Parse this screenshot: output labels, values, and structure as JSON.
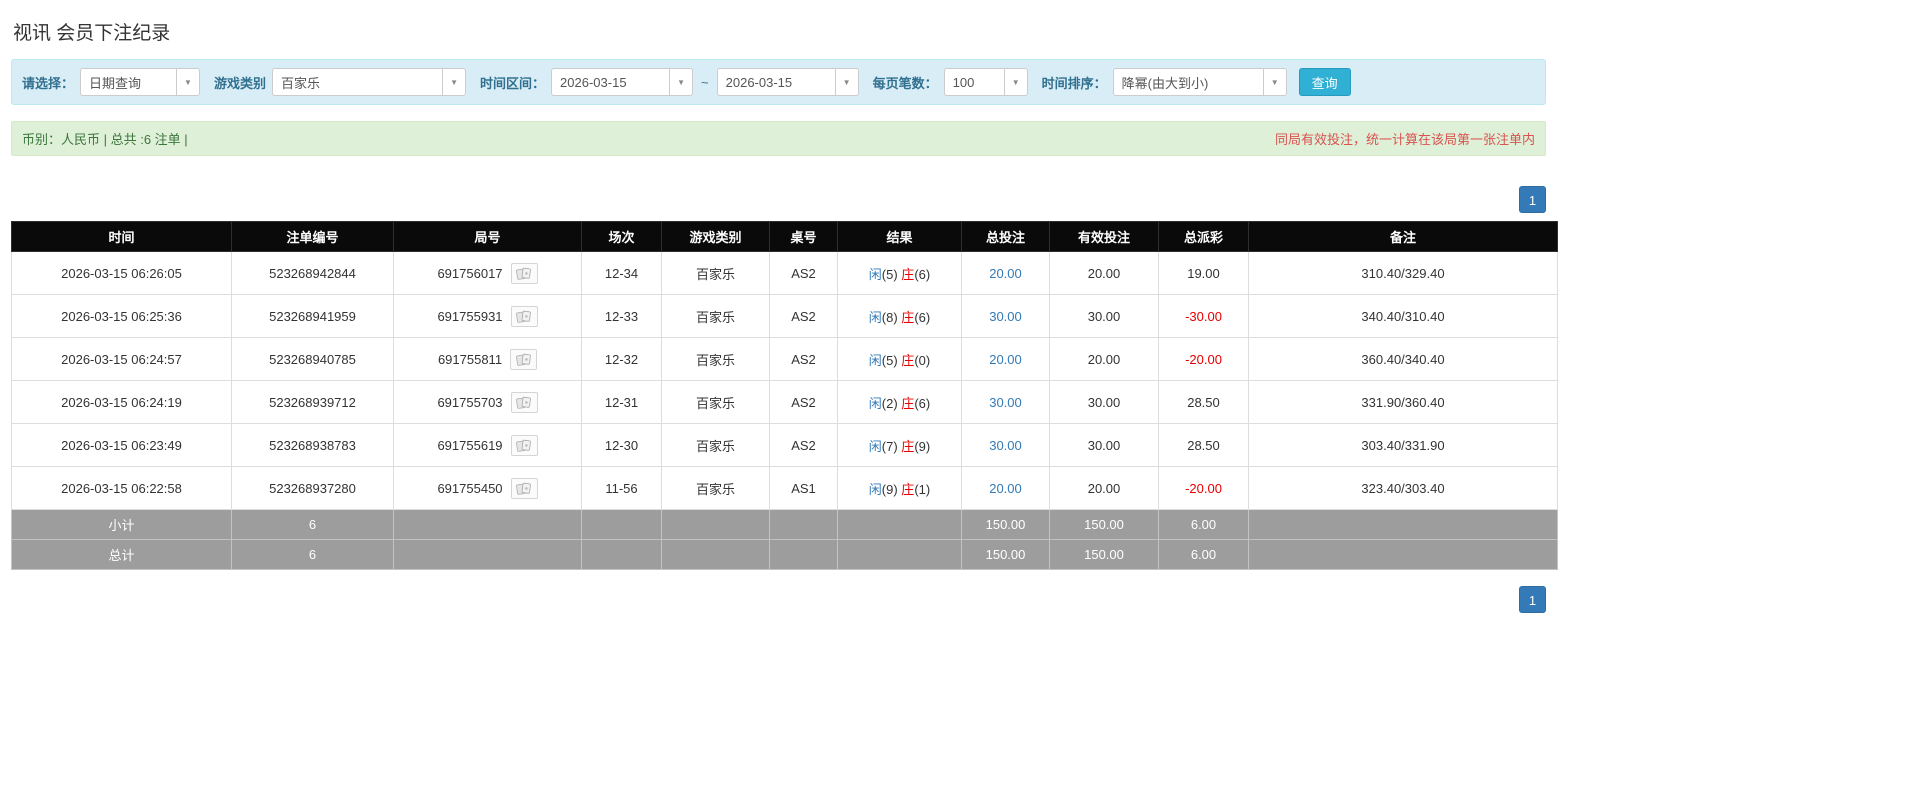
{
  "page": {
    "title": "视讯 会员下注纪录"
  },
  "icons": {
    "caret_down": "▼"
  },
  "colors": {
    "accent_blue": "#337ab7",
    "button_blue": "#31b0d5",
    "filter_bar_bg": "#d9edf7",
    "info_bar_bg": "#dff0d8",
    "info_text_green": "#3c763d",
    "warning_red": "#d9534f",
    "negative_red": "#e60000",
    "header_black": "#0a0a0a",
    "footer_gray": "#9d9d9d"
  },
  "filters": {
    "select_label": "请选择：",
    "select_value": "日期查询",
    "game_type_label": "游戏类别",
    "game_type_value": "百家乐",
    "date_range_label": "时间区间：",
    "date_from": "2026-03-15",
    "date_separator": "~",
    "date_to": "2026-03-15",
    "page_size_label": "每页笔数：",
    "page_size_value": "100",
    "sort_label": "时间排序：",
    "sort_value": "降幂(由大到小)",
    "search_button": "查询"
  },
  "info_bar": {
    "left_text": "币别：人民币 | 总共 :6 注单 |",
    "right_text": "同局有效投注，统一计算在该局第一张注单内"
  },
  "pagination": {
    "page": "1"
  },
  "table": {
    "headers": [
      "时间",
      "注单编号",
      "局号",
      "场次",
      "游戏类别",
      "桌号",
      "结果",
      "总投注",
      "有效投注",
      "总派彩",
      "备注"
    ],
    "rows": [
      {
        "time": "2026-03-15 06:26:05",
        "bet_id": "523268942844",
        "round_id": "691756017",
        "session": "12-34",
        "game": "百家乐",
        "table_no": "AS2",
        "result": {
          "player_label": "闲",
          "player": "5",
          "banker_label": "庄",
          "banker": "6"
        },
        "total_bet": "20.00",
        "valid_bet": "20.00",
        "payout": "19.00",
        "remark": "310.40/329.40"
      },
      {
        "time": "2026-03-15 06:25:36",
        "bet_id": "523268941959",
        "round_id": "691755931",
        "session": "12-33",
        "game": "百家乐",
        "table_no": "AS2",
        "result": {
          "player_label": "闲",
          "player": "8",
          "banker_label": "庄",
          "banker": "6"
        },
        "total_bet": "30.00",
        "valid_bet": "30.00",
        "payout": "-30.00",
        "remark": "340.40/310.40"
      },
      {
        "time": "2026-03-15 06:24:57",
        "bet_id": "523268940785",
        "round_id": "691755811",
        "session": "12-32",
        "game": "百家乐",
        "table_no": "AS2",
        "result": {
          "player_label": "闲",
          "player": "5",
          "banker_label": "庄",
          "banker": "0"
        },
        "total_bet": "20.00",
        "valid_bet": "20.00",
        "payout": "-20.00",
        "remark": "360.40/340.40"
      },
      {
        "time": "2026-03-15 06:24:19",
        "bet_id": "523268939712",
        "round_id": "691755703",
        "session": "12-31",
        "game": "百家乐",
        "table_no": "AS2",
        "result": {
          "player_label": "闲",
          "player": "2",
          "banker_label": "庄",
          "banker": "6"
        },
        "total_bet": "30.00",
        "valid_bet": "30.00",
        "payout": "28.50",
        "remark": "331.90/360.40"
      },
      {
        "time": "2026-03-15 06:23:49",
        "bet_id": "523268938783",
        "round_id": "691755619",
        "session": "12-30",
        "game": "百家乐",
        "table_no": "AS2",
        "result": {
          "player_label": "闲",
          "player": "7",
          "banker_label": "庄",
          "banker": "9"
        },
        "total_bet": "30.00",
        "valid_bet": "30.00",
        "payout": "28.50",
        "remark": "303.40/331.90"
      },
      {
        "time": "2026-03-15 06:22:58",
        "bet_id": "523268937280",
        "round_id": "691755450",
        "session": "11-56",
        "game": "百家乐",
        "table_no": "AS1",
        "result": {
          "player_label": "闲",
          "player": "9",
          "banker_label": "庄",
          "banker": "1"
        },
        "total_bet": "20.00",
        "valid_bet": "20.00",
        "payout": "-20.00",
        "remark": "323.40/303.40"
      }
    ],
    "footer": [
      {
        "label": "小计",
        "count": "6",
        "total_bet": "150.00",
        "valid_bet": "150.00",
        "payout": "6.00"
      },
      {
        "label": "总计",
        "count": "6",
        "total_bet": "150.00",
        "valid_bet": "150.00",
        "payout": "6.00"
      }
    ]
  }
}
